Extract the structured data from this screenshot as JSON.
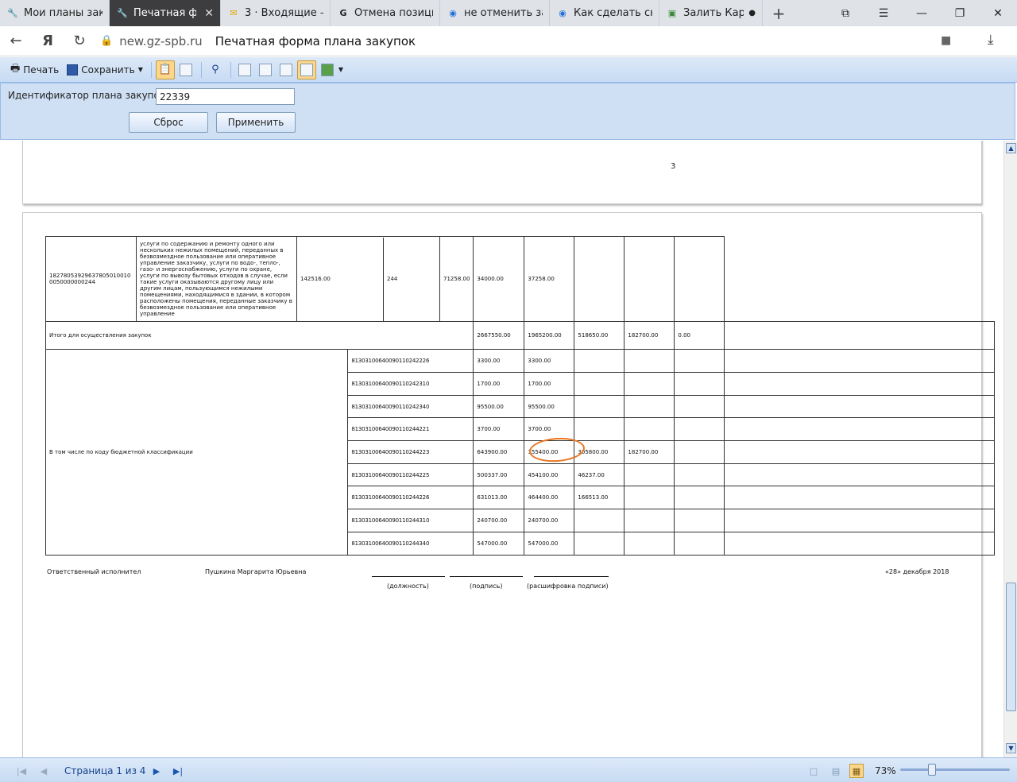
{
  "tabs": [
    {
      "title": "Мои планы заку",
      "icon": "tools-icon",
      "active": false
    },
    {
      "title": "Печатная фор",
      "icon": "tools-icon",
      "active": true
    },
    {
      "title": "3 · Входящие —",
      "icon": "mail-icon",
      "active": false
    },
    {
      "title": "Отмена позици",
      "icon": "g-icon",
      "active": false
    },
    {
      "title": "не отменить зак",
      "icon": "globe-icon",
      "active": false
    },
    {
      "title": "Как сделать сни",
      "icon": "globe-icon",
      "active": false
    },
    {
      "title": "Залить Карти",
      "icon": "image-icon",
      "active": false
    }
  ],
  "address": {
    "host": "new.gz-spb.ru",
    "title": "Печатная форма плана закупок"
  },
  "toolbar": {
    "print_label": "Печать",
    "save_label": "Сохранить"
  },
  "params": {
    "label": "Идентификатор плана закупок",
    "value": "22339",
    "reset_label": "Сброс",
    "apply_label": "Применить"
  },
  "prev_page_number": "3",
  "row1": {
    "code": "182780539296378050100100050000000244",
    "desc": "услуги по содержанию и ремонту одного или нескольких нежилых помещений, переданных в безвозмездное пользование или оперативное управление заказчику, услуги по водо-, тепло-, газо- и энергоснабжению, услуги по охране, услуги по вывозу бытовых отходов в случае, если такие услуги оказываются другому лицу или другим лицам, пользующимся нежилыми помещениями, находящимися в здании, в котором расположены помещения, переданные заказчику в безвозмездное пользование или оперативное управление",
    "c3": "142516.00",
    "c4": "244",
    "c5": "71258.00",
    "c6": "34000.00",
    "c7": "37258.00"
  },
  "total": {
    "label": "Итого для осуществления закупок",
    "c5": "2667550.00",
    "c6": "1965200.00",
    "c7": "518650.00",
    "c8": "182700.00",
    "c9": "0.00"
  },
  "budget_label": "В том числе по коду бюджетной классификации",
  "kbk_rows": [
    {
      "kbk": "81303100640090110242226",
      "c5": "3300.00",
      "c6": "3300.00",
      "c7": "",
      "c8": ""
    },
    {
      "kbk": "81303100640090110242310",
      "c5": "1700.00",
      "c6": "1700.00",
      "c7": "",
      "c8": ""
    },
    {
      "kbk": "81303100640090110242340",
      "c5": "95500.00",
      "c6": "95500.00",
      "c7": "",
      "c8": ""
    },
    {
      "kbk": "81303100640090110244221",
      "c5": "3700.00",
      "c6": "3700.00",
      "c7": "",
      "c8": ""
    },
    {
      "kbk": "81303100640090110244223",
      "c5": "643900.00",
      "c6": "155400.00",
      "c7": "305800.00",
      "c8": "182700.00"
    },
    {
      "kbk": "81303100640090110244225",
      "c5": "500337.00",
      "c6": "454100.00",
      "c7": "46237.00",
      "c8": ""
    },
    {
      "kbk": "81303100640090110244226",
      "c5": "631013.00",
      "c6": "464400.00",
      "c7": "166513.00",
      "c8": ""
    },
    {
      "kbk": "81303100640090110244310",
      "c5": "240700.00",
      "c6": "240700.00",
      "c7": "",
      "c8": ""
    },
    {
      "kbk": "81303100640090110244340",
      "c5": "547000.00",
      "c6": "547000.00",
      "c7": "",
      "c8": ""
    }
  ],
  "signature": {
    "role": "Ответственный исполнител",
    "name": "Пушкина Маргарита Юрьевна",
    "position_caption": "(должность)",
    "sign_caption": "(подпись)",
    "decode_caption": "(расшифровка подписи)",
    "date": "«28» декабря 2018"
  },
  "status": {
    "page_text": "Страница 1 из 4",
    "zoom": "73%",
    "zoom_level": 0.27
  }
}
